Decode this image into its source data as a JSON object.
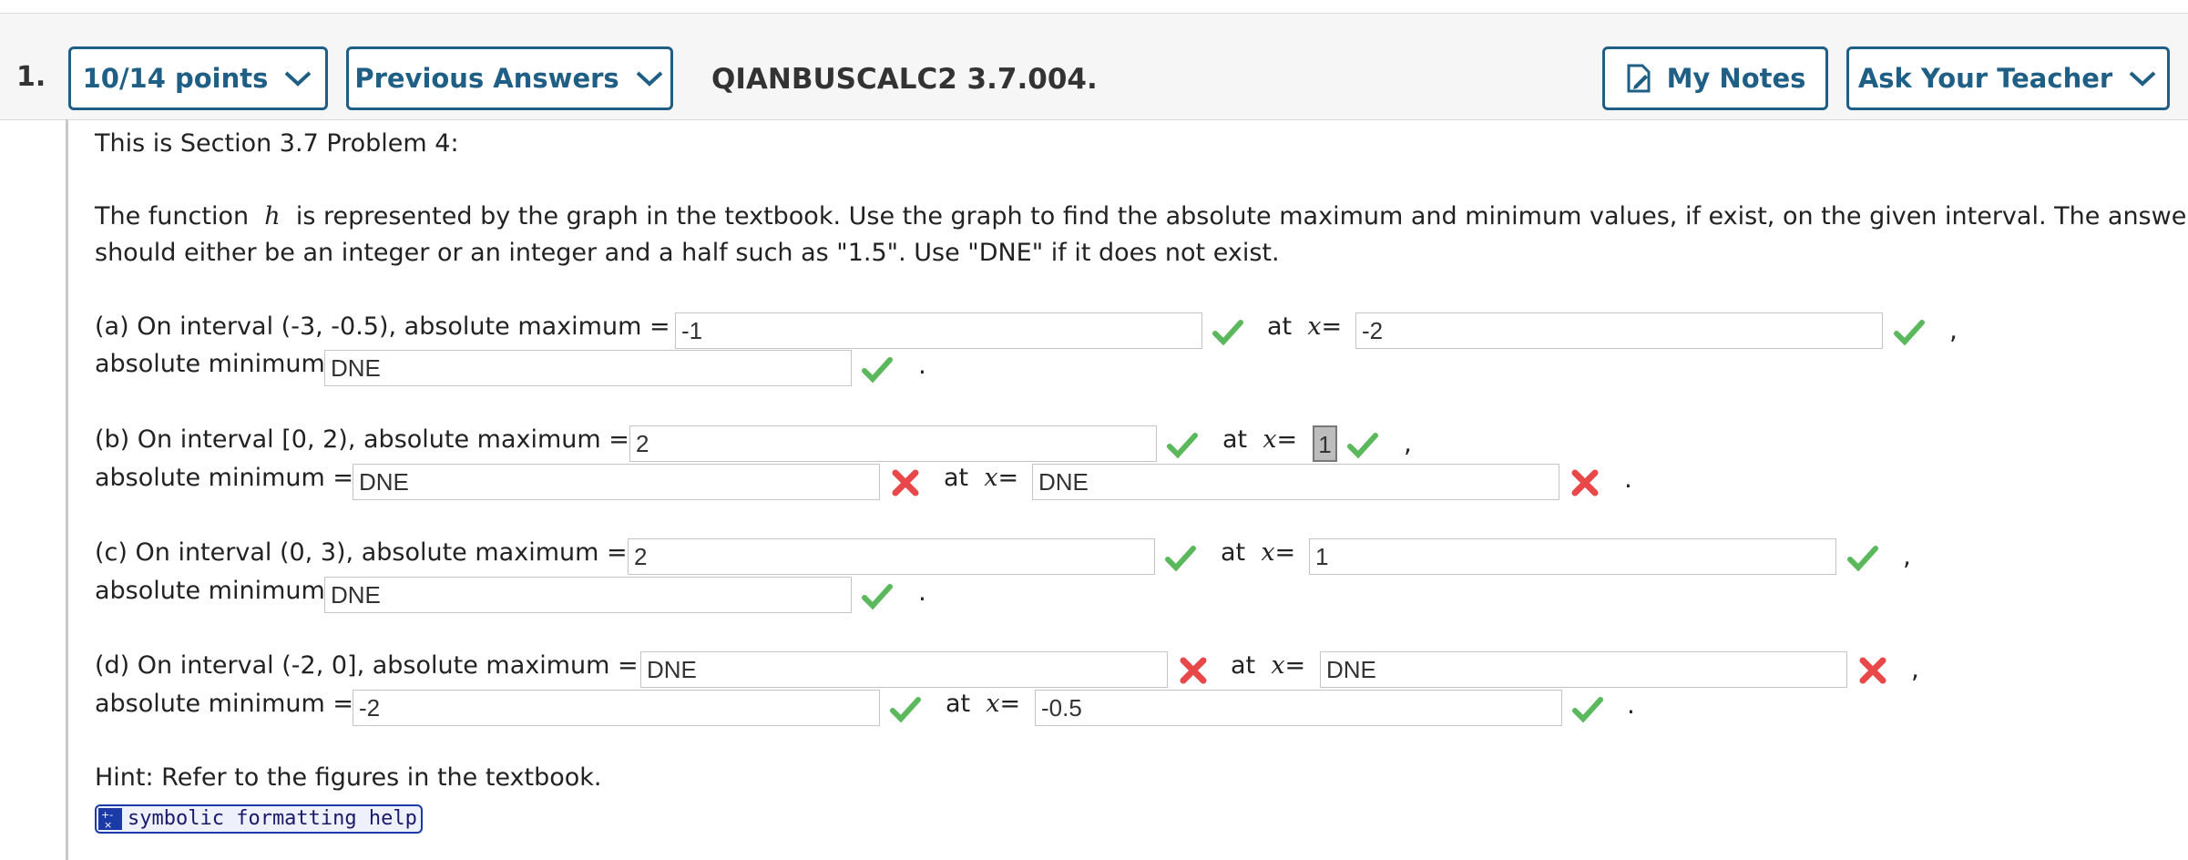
{
  "header": {
    "question_number": "1.",
    "points": "10/14 points",
    "previous_answers": "Previous Answers",
    "problem_id": "QIANBUSCALC2 3.7.004.",
    "my_notes": "My Notes",
    "ask_teacher": "Ask Your Teacher"
  },
  "problem": {
    "section": "This is Section 3.7 Problem 4:",
    "intro_1a": "The function",
    "fn": "h",
    "intro_1b": "is represented by the graph in the textbook. Use the graph to find the absolute maximum and minimum values, if exist, on the given interval. The answers",
    "intro_2": "should either be an integer or an integer and a half such as \"1.5\". Use \"DNE\" if it does not exist.",
    "at_x": "at",
    "x_var": "x",
    "eq": "=",
    "comma": ",",
    "period": ".",
    "parts": [
      {
        "label": "(a) On interval (-3, -0.5), absolute maximum =",
        "max": "-1",
        "max_mark": "correct",
        "max_x": "-2",
        "max_x_mark": "correct",
        "min_label": "absolute minimum",
        "min": "DNE",
        "min_mark": "correct"
      },
      {
        "label": "(b) On interval [0, 2), absolute maximum =",
        "max": "2",
        "max_mark": "correct",
        "max_x": "1",
        "max_x_mark": "correct",
        "min_label": "absolute minimum =",
        "min": "DNE",
        "min_mark": "incorrect",
        "min_x": "DNE",
        "min_x_mark": "incorrect"
      },
      {
        "label": "(c) On interval (0, 3), absolute maximum =",
        "max": "2",
        "max_mark": "correct",
        "max_x": "1",
        "max_x_mark": "correct",
        "min_label": "absolute minimum",
        "min": "DNE",
        "min_mark": "correct"
      },
      {
        "label": "(d) On interval (-2, 0], absolute maximum =",
        "max": "DNE",
        "max_mark": "incorrect",
        "max_x": "DNE",
        "max_x_mark": "incorrect",
        "min_label": "absolute minimum =",
        "min": "-2",
        "min_mark": "correct",
        "min_x": "-0.5",
        "min_x_mark": "correct"
      }
    ],
    "hint": "Hint: Refer to the figures in the textbook.",
    "help_link": "symbolic formatting help"
  },
  "colors": {
    "accent": "#1f5f85",
    "correct": "#5cb85c",
    "incorrect": "#e8484a"
  }
}
